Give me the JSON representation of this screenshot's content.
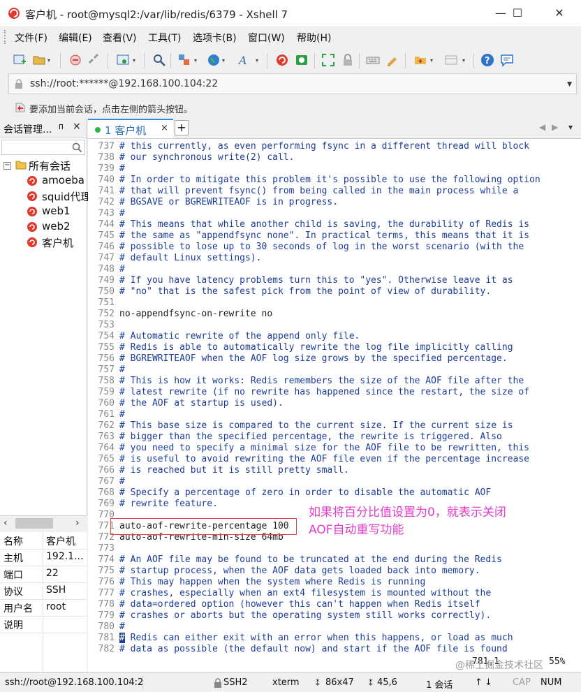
{
  "window": {
    "title": "客户机 - root@mysql2:/var/lib/redis/6379 - Xshell 7",
    "controls": [
      "—",
      "☐",
      "✕"
    ]
  },
  "menu": [
    "文件(F)",
    "编辑(E)",
    "查看(V)",
    "工具(T)",
    "选项卡(B)",
    "窗口(W)",
    "帮助(H)"
  ],
  "address": {
    "value": "ssh://root:******@192.168.100.104:22"
  },
  "hint": "要添加当前会话，点击左侧的箭头按钮。",
  "session_manager": {
    "title": "会话管理...",
    "pin": "ᴨ",
    "close": "×",
    "root": "所有会话",
    "sessions": [
      "amoeba",
      "squid代理",
      "web1",
      "web2",
      "客户机"
    ]
  },
  "properties": [
    {
      "key": "名称",
      "value": "客户机"
    },
    {
      "key": "主机",
      "value": "192.1..."
    },
    {
      "key": "端口",
      "value": "22"
    },
    {
      "key": "协议",
      "value": "SSH"
    },
    {
      "key": "用户名",
      "value": "root"
    },
    {
      "key": "说明",
      "value": ""
    }
  ],
  "tab": {
    "label": "1 客户机",
    "close": "×",
    "add": "+"
  },
  "terminal": {
    "lines": [
      {
        "n": "737",
        "t": "# this currently, as even performing fsync in a different thread will block"
      },
      {
        "n": "738",
        "t": "# our synchronous write(2) call."
      },
      {
        "n": "739",
        "t": "#"
      },
      {
        "n": "740",
        "t": "# In order to mitigate this problem it's possible to use the following option"
      },
      {
        "n": "741",
        "t": "# that will prevent fsync() from being called in the main process while a"
      },
      {
        "n": "742",
        "t": "# BGSAVE or BGREWRITEAOF is in progress."
      },
      {
        "n": "743",
        "t": "#"
      },
      {
        "n": "744",
        "t": "# This means that while another child is saving, the durability of Redis is"
      },
      {
        "n": "745",
        "t": "# the same as \"appendfsync none\". In practical terms, this means that it is"
      },
      {
        "n": "746",
        "t": "# possible to lose up to 30 seconds of log in the worst scenario (with the"
      },
      {
        "n": "747",
        "t": "# default Linux settings)."
      },
      {
        "n": "748",
        "t": "#"
      },
      {
        "n": "749",
        "t": "# If you have latency problems turn this to \"yes\". Otherwise leave it as"
      },
      {
        "n": "750",
        "t": "# \"no\" that is the safest pick from the point of view of durability."
      },
      {
        "n": "751",
        "t": ""
      },
      {
        "n": "752",
        "t": "no-appendfsync-on-rewrite no"
      },
      {
        "n": "753",
        "t": ""
      },
      {
        "n": "754",
        "t": "# Automatic rewrite of the append only file."
      },
      {
        "n": "755",
        "t": "# Redis is able to automatically rewrite the log file implicitly calling"
      },
      {
        "n": "756",
        "t": "# BGREWRITEAOF when the AOF log size grows by the specified percentage."
      },
      {
        "n": "757",
        "t": "#"
      },
      {
        "n": "758",
        "t": "# This is how it works: Redis remembers the size of the AOF file after the"
      },
      {
        "n": "759",
        "t": "# latest rewrite (if no rewrite has happened since the restart, the size of"
      },
      {
        "n": "760",
        "t": "# the AOF at startup is used)."
      },
      {
        "n": "761",
        "t": "#"
      },
      {
        "n": "762",
        "t": "# This base size is compared to the current size. If the current size is"
      },
      {
        "n": "763",
        "t": "# bigger than the specified percentage, the rewrite is triggered. Also"
      },
      {
        "n": "764",
        "t": "# you need to specify a minimal size for the AOF file to be rewritten, this"
      },
      {
        "n": "765",
        "t": "# is useful to avoid rewriting the AOF file even if the percentage increase"
      },
      {
        "n": "766",
        "t": "# is reached but it is still pretty small."
      },
      {
        "n": "767",
        "t": "#"
      },
      {
        "n": "768",
        "t": "# Specify a percentage of zero in order to disable the automatic AOF"
      },
      {
        "n": "769",
        "t": "# rewrite feature."
      },
      {
        "n": "770",
        "t": ""
      },
      {
        "n": "771",
        "t": "auto-aof-rewrite-percentage 100"
      },
      {
        "n": "772",
        "t": "auto-aof-rewrite-min-size 64mb"
      },
      {
        "n": "773",
        "t": ""
      },
      {
        "n": "774",
        "t": "# An AOF file may be found to be truncated at the end during the Redis"
      },
      {
        "n": "775",
        "t": "# startup process, when the AOF data gets loaded back into memory."
      },
      {
        "n": "776",
        "t": "# This may happen when the system where Redis is running"
      },
      {
        "n": "777",
        "t": "# crashes, especially when an ext4 filesystem is mounted without the"
      },
      {
        "n": "778",
        "t": "# data=ordered option (however this can't happen when Redis itself"
      },
      {
        "n": "779",
        "t": "# crashes or aborts but the operating system still works correctly)."
      },
      {
        "n": "780",
        "t": "#"
      },
      {
        "n": "781",
        "t": "# Redis can either exit with an error when this happens, or load as much"
      },
      {
        "n": "782",
        "t": "# data as possible (the default now) and start if the AOF file is found"
      }
    ],
    "vim_position": "781,1",
    "vim_percent": "55%",
    "annotation_line1": "如果将百分比值设置为0，就表示关闭",
    "annotation_line2": "AOF自动重写功能",
    "watermark": "@稀土掘金技术社区"
  },
  "statusbar": {
    "connection": "ssh://root@192.168.100.104:2",
    "protocol": "SSH2",
    "term": "xterm",
    "size": "86x47",
    "cursor": "45,6",
    "sessions": "1 会话",
    "caps": "CAP",
    "num": "NUM"
  },
  "colors": {
    "comment": "#1d3c9a",
    "annotation": "#e13ccc",
    "highlight_box": "#e04444",
    "tab_accent": "#2e8ee0"
  }
}
